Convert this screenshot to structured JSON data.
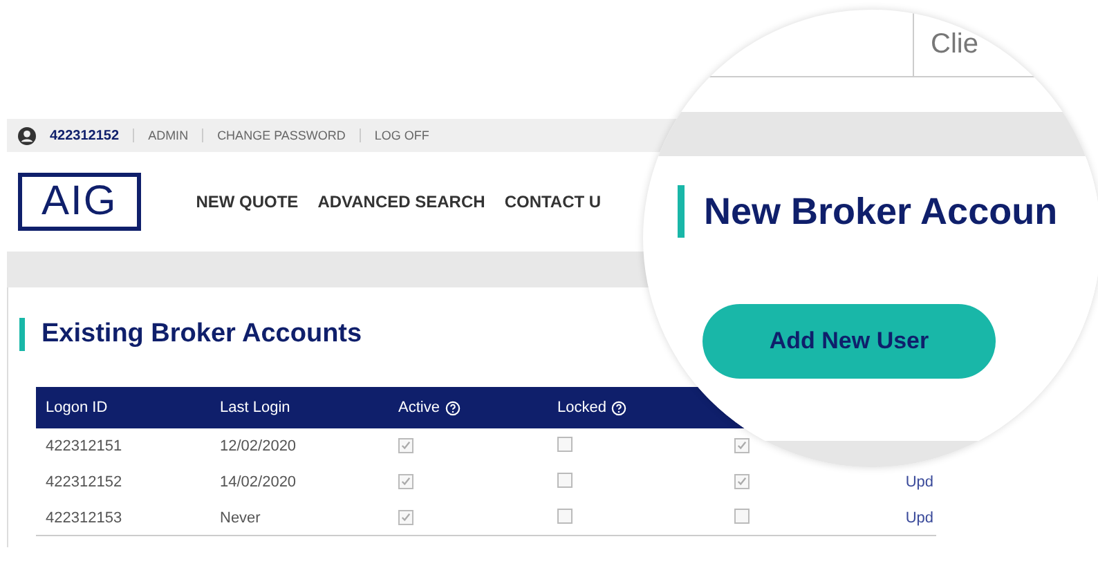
{
  "top_bar": {
    "user_id": "422312152",
    "links": [
      "ADMIN",
      "CHANGE PASSWORD",
      "LOG OFF"
    ]
  },
  "header": {
    "logo": "AIG",
    "nav": [
      "NEW QUOTE",
      "ADVANCED SEARCH",
      "CONTACT U"
    ]
  },
  "existing_accounts": {
    "title": "Existing Broker Accounts",
    "table": {
      "columns": [
        {
          "label": "Logon ID",
          "kind": "plain"
        },
        {
          "label": "Last Login",
          "kind": "plain"
        },
        {
          "label": "Active",
          "kind": "help"
        },
        {
          "label": "Locked",
          "kind": "help"
        }
      ],
      "rows": [
        {
          "logon_id": "422312151",
          "last_login": "12/02/2020",
          "active": true,
          "locked": false,
          "column_5": true
        },
        {
          "logon_id": "422312152",
          "last_login": "14/02/2020",
          "active": true,
          "locked": false,
          "column_5": true,
          "column_6": "Upd"
        },
        {
          "logon_id": "422312153",
          "last_login": "Never",
          "active": true,
          "locked": false,
          "column_5": false,
          "column_6": "Upd"
        }
      ]
    }
  },
  "magnifier": {
    "tab": "Clie",
    "section_title": "New Broker Accoun",
    "button": "Add New User"
  }
}
